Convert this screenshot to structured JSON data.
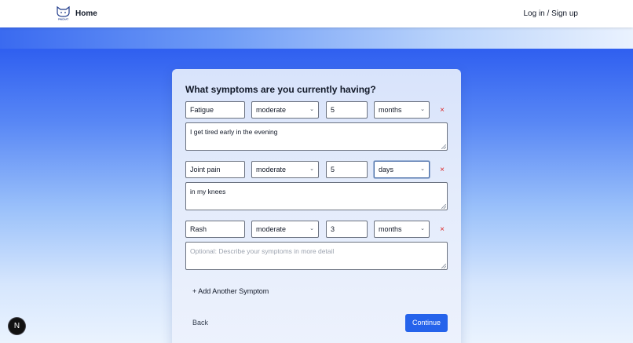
{
  "nav": {
    "logo_icon": "cat-logo-icon",
    "logo_text": "PINCHAT",
    "home_label": "Home",
    "auth_label": "Log in / Sign up"
  },
  "form": {
    "title": "What symptoms are you currently having?",
    "symptoms": [
      {
        "name": "Fatigue",
        "severity": "moderate",
        "duration": "5",
        "unit": "months",
        "description": "I get tired early in the evening"
      },
      {
        "name": "Joint pain",
        "severity": "moderate",
        "duration": "5",
        "unit": "days",
        "description": "in my knees"
      },
      {
        "name": "Rash",
        "severity": "moderate",
        "duration": "3",
        "unit": "months",
        "description": "",
        "description_placeholder": "Optional: Describe your symptoms in more detail"
      }
    ],
    "remove_glyph": "×",
    "chevron_glyph": "⌄",
    "add_label": "+ Add Another Symptom",
    "back_label": "Back",
    "continue_label": "Continue"
  },
  "dev_badge": {
    "label": "N",
    "icon": "nextjs-icon"
  },
  "colors": {
    "primary": "#2563eb",
    "remove": "#dc2626",
    "accent_bg": "#2f5fe8"
  }
}
